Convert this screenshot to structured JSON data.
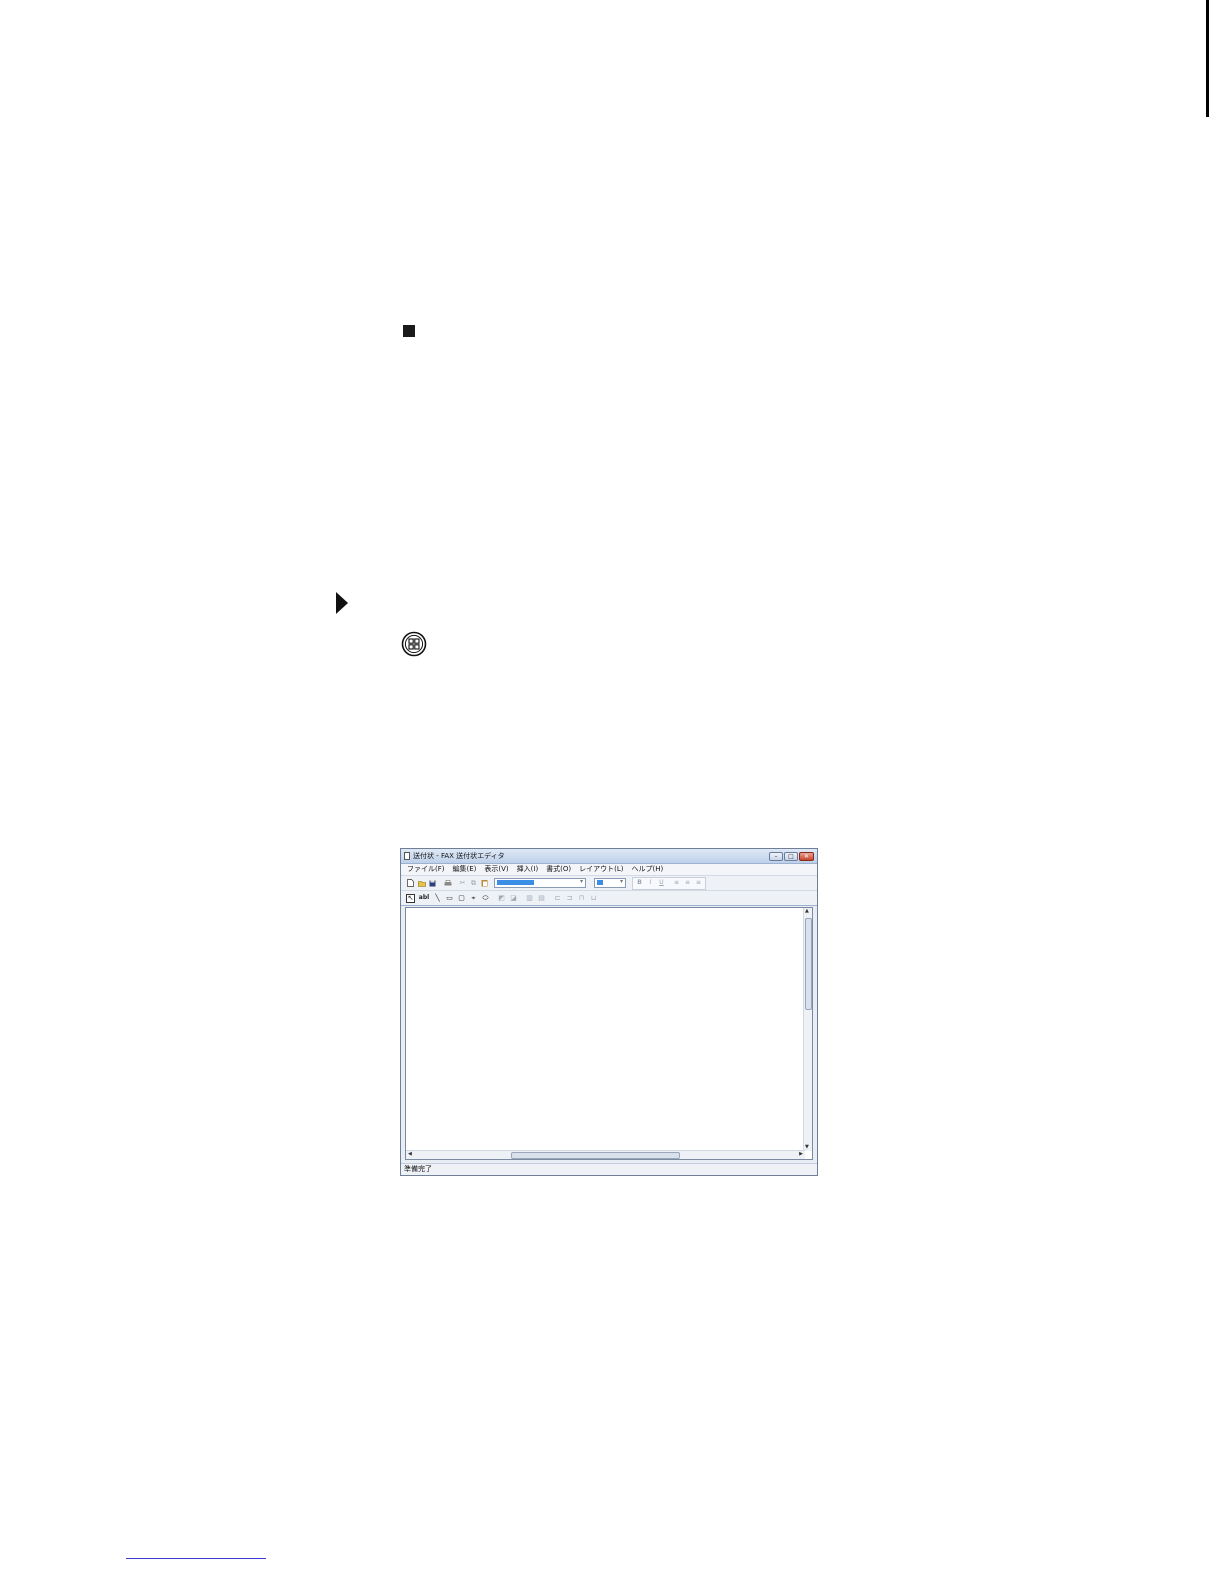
{
  "window": {
    "title": "送付状 - FAX 送付状エディタ",
    "controls": {
      "minimize": "–",
      "maximize": "□",
      "close": "✕"
    }
  },
  "menu": [
    "ファイル(F)",
    "編集(E)",
    "表示(V)",
    "挿入(I)",
    "書式(O)",
    "レイアウト(L)",
    "ヘルプ(H)"
  ],
  "toolbar": {
    "format_buttons": {
      "bold": "B",
      "italic": "I",
      "underline": "U"
    }
  },
  "drawing_tools": {
    "text_tool": "abl"
  },
  "status": {
    "text": "準備完了"
  },
  "icons": [
    "bullet-square",
    "step-arrow",
    "windows-start-icon",
    "new-document-icon",
    "open-folder-icon",
    "save-icon",
    "print-icon",
    "cut-icon",
    "copy-icon",
    "paste-icon"
  ]
}
